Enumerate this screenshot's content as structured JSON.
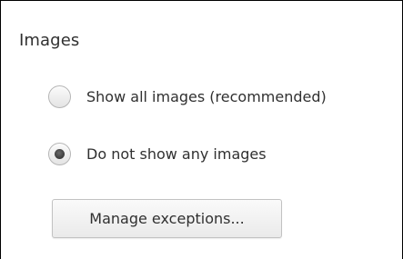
{
  "section": {
    "title": "Images"
  },
  "options": [
    {
      "label": "Show all images (recommended)",
      "checked": false
    },
    {
      "label": "Do not show any images",
      "checked": true
    }
  ],
  "buttons": {
    "manage_exceptions": "Manage exceptions..."
  }
}
